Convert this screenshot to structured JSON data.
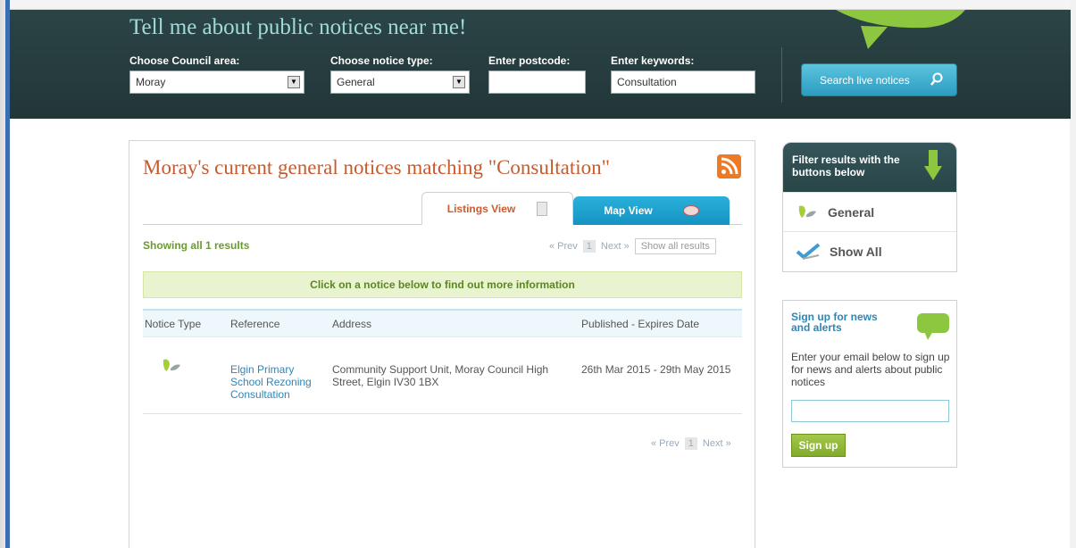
{
  "header": {
    "title": "Tell me about public notices near me!",
    "council_label": "Choose Council area:",
    "council_value": "Moray",
    "type_label": "Choose notice type:",
    "type_value": "General",
    "postcode_label": "Enter postcode:",
    "postcode_value": "",
    "keywords_label": "Enter keywords:",
    "keywords_value": "Consultation",
    "search_button": "Search live notices"
  },
  "main": {
    "title": "Moray's current general notices matching \"Consultation\"",
    "tabs": [
      {
        "label": "Listings View"
      },
      {
        "label": "Map View"
      }
    ],
    "showing": "Showing all 1 results",
    "pager": {
      "prev": "« Prev",
      "page": "1",
      "next": "Next »",
      "show_all": "Show all results"
    },
    "banner": "Click on a notice below to find out more information",
    "columns": [
      "Notice Type",
      "Reference",
      "Address",
      "Published - Expires Date"
    ],
    "rows": [
      {
        "reference": "Elgin Primary School Rezoning Consultation",
        "address": "Community Support Unit, Moray Council High Street, Elgin IV30 1BX",
        "dates": "26th Mar 2015 - 29th May 2015"
      }
    ]
  },
  "sidebar": {
    "filter_title": "Filter results with the buttons below",
    "filters": [
      {
        "label": "General"
      },
      {
        "label": "Show All"
      }
    ],
    "signup_title": "Sign up for news and alerts",
    "signup_text": "Enter your email below to sign up for news and alerts about public notices",
    "signup_button": "Sign up"
  },
  "colors": {
    "header_bg": "#23393b",
    "title_accent": "#c85a2c",
    "link": "#2e86b7",
    "green": "#6b9a2e",
    "tab_blue": "#1593c2"
  }
}
